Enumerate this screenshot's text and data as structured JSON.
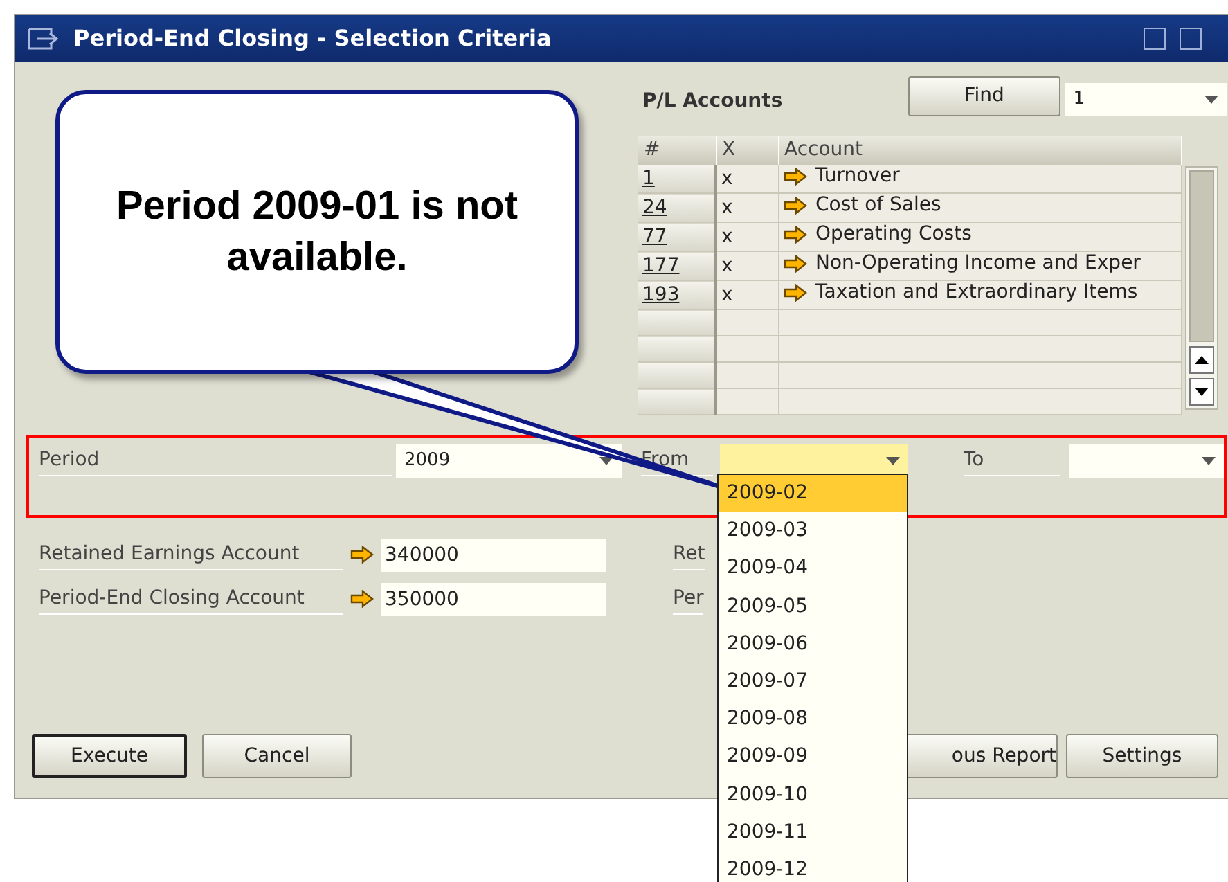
{
  "window": {
    "title": "Period-End Closing - Selection Criteria"
  },
  "callout": {
    "text": "Period 2009-01 is not available."
  },
  "accounts": {
    "label": "P/L Accounts",
    "find_button": "Find",
    "combo_value": "1",
    "columns": [
      "#",
      "X",
      "Account"
    ],
    "rows": [
      {
        "number": "1",
        "x": "x",
        "account": "Turnover"
      },
      {
        "number": "24",
        "x": "x",
        "account": "Cost of Sales"
      },
      {
        "number": "77",
        "x": "x",
        "account": "Operating Costs"
      },
      {
        "number": "177",
        "x": "x",
        "account": "Non-Operating Income and Exper"
      },
      {
        "number": "193",
        "x": "x",
        "account": "Taxation and Extraordinary Items"
      }
    ]
  },
  "period_criteria": {
    "period": {
      "label": "Period",
      "value": "2009",
      "focused": false
    },
    "from": {
      "label": "From",
      "focused": true
    },
    "to": {
      "label": "To",
      "focused": false
    }
  },
  "from_dropdown": {
    "options": [
      {
        "label": "2009-02",
        "selected": true
      },
      {
        "label": "2009-03",
        "selected": false
      },
      {
        "label": "2009-04",
        "selected": false
      },
      {
        "label": "2009-05",
        "selected": false
      },
      {
        "label": "2009-06",
        "selected": false
      },
      {
        "label": "2009-07",
        "selected": false
      },
      {
        "label": "2009-08",
        "selected": false
      },
      {
        "label": "2009-09",
        "selected": false
      },
      {
        "label": "2009-10",
        "selected": false
      },
      {
        "label": "2009-11",
        "selected": false
      },
      {
        "label": "2009-12",
        "selected": false
      }
    ]
  },
  "fields": [
    {
      "label": "Retained Earnings Account",
      "value": "340000",
      "side_label": "Ret"
    },
    {
      "label": "Period-End Closing Account",
      "value": "350000",
      "side_label": "Per"
    }
  ],
  "buttons": [
    {
      "label": "Execute",
      "default": true
    },
    {
      "label": "Cancel",
      "default": false
    },
    {
      "label": "ous Report",
      "default": false
    },
    {
      "label": "Settings",
      "default": false
    }
  ]
}
